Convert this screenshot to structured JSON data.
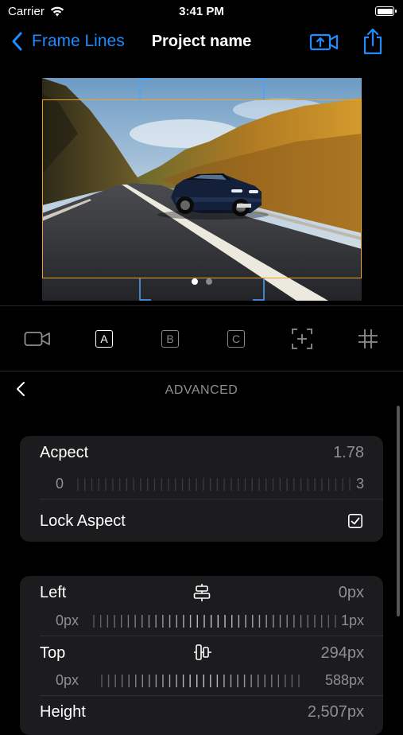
{
  "status": {
    "carrier": "Carrier",
    "time": "3:41 PM"
  },
  "nav": {
    "back_label": "Frame Lines",
    "title": "Project name",
    "accent": "#1e8cff"
  },
  "preview": {
    "page_count": 2,
    "active_page": 1,
    "frame_color": "#f0a020",
    "guide_color": "#4aa3ff"
  },
  "toolbar": {
    "items": [
      {
        "icon": "video-camera-icon",
        "label": ""
      },
      {
        "icon": "frame-a-icon",
        "label": "A",
        "active": true
      },
      {
        "icon": "frame-b-icon",
        "label": "B"
      },
      {
        "icon": "frame-c-icon",
        "label": "C"
      },
      {
        "icon": "add-frame-icon",
        "label": ""
      },
      {
        "icon": "grid-icon",
        "label": ""
      }
    ]
  },
  "advanced": {
    "title": "ADVANCED"
  },
  "aspect_card": {
    "aspect_label": "Acpect",
    "aspect_value": "1.78",
    "slider_min": "0",
    "slider_max": "3",
    "lock_label": "Lock Aspect",
    "lock_checked": true
  },
  "position_card": {
    "left_label": "Left",
    "left_value": "0px",
    "left_min": "0px",
    "left_max": "1px",
    "top_label": "Top",
    "top_value": "294px",
    "top_min": "0px",
    "top_max": "588px",
    "height_label": "Height",
    "height_value": "2,507px"
  }
}
